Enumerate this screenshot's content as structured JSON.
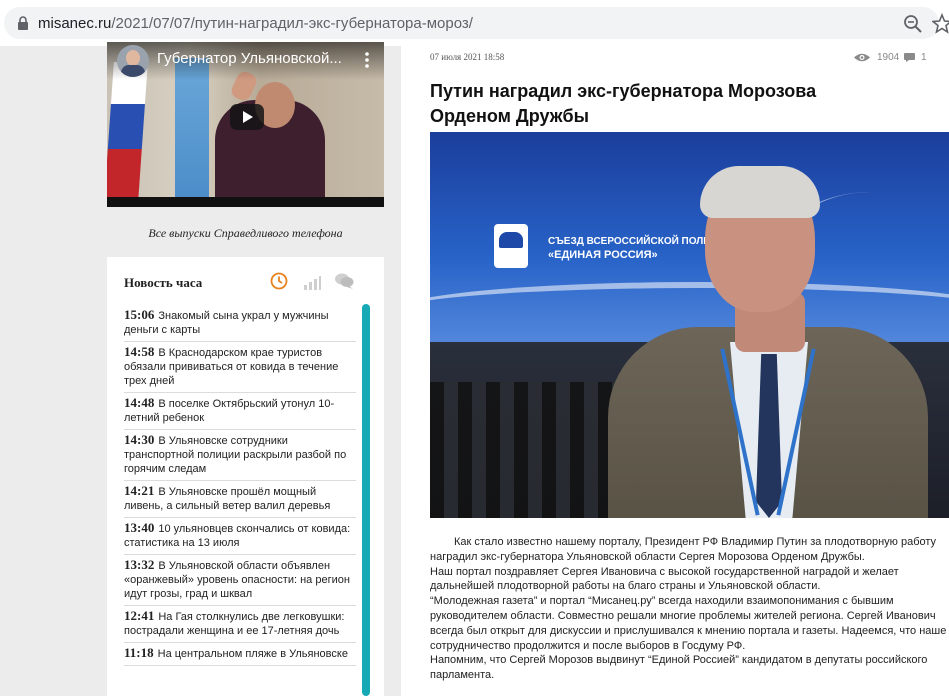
{
  "browser": {
    "url_domain": "misanec.ru",
    "url_path": "/2021/07/07/путин-наградил-экс-губернатора-мороз/"
  },
  "video": {
    "title": "Губернатор Ульяновской..."
  },
  "episodes_link": "Все выпуски Справедливого телефона",
  "news_hour": {
    "title": "Новость часа",
    "items": [
      {
        "time": "15:06",
        "text": "Знакомый сына украл у мужчины деньги с карты"
      },
      {
        "time": "14:58",
        "text": "В Краснодарском крае туристов обязали прививаться от ковида в течение трех дней"
      },
      {
        "time": "14:48",
        "text": "В поселке Октябрьский утонул 10-летний ребенок"
      },
      {
        "time": "14:30",
        "text": "В Ульяновске сотрудники транспортной полиции раскрыли разбой по горячим следам"
      },
      {
        "time": "14:21",
        "text": "В Ульяновске прошёл мощный ливень, а сильный ветер валил деревья"
      },
      {
        "time": "13:40",
        "text": "10 ульяновцев скончались от ковида: статистика на 13 июля"
      },
      {
        "time": "13:32",
        "text": "В Ульяновской области объявлен «оранжевый» уровень опасности: на регион идут грозы, град и шквал"
      },
      {
        "time": "12:41",
        "text": "На Гая столкнулись две легковушки: пострадали женщина и ее 17-летняя дочь"
      },
      {
        "time": "11:18",
        "text": "На центральном пляже в Ульяновске"
      }
    ]
  },
  "article": {
    "date": "07 июля 2021 18:58",
    "views": "1904",
    "comments": "1",
    "headline": "Путин наградил экс-губернатора Морозова Орденом Дружбы",
    "photo_text_line1": "СЪЕЗД ВСЕРОССИЙСКОЙ ПОЛИТИЧЕ",
    "photo_text_line2": "«ЕДИНАЯ РОССИЯ»",
    "paragraphs": [
      "Как стало известно нашему порталу, Президент РФ Владимир Путин за плодотворную работу наградил экс-губернатора Ульяновской области Сергея Морозова Орденом Дружбы.",
      "Наш портал поздравляет Сергея Ивановича с высокой государственной наградой и желает дальнейшей плодотворной работы на благо страны и Ульяновской области.",
      "“Молодежная газета” и портал “Мисанец.ру” всегда находили взаимопонимания с бывшим руководителем области. Совместно решали многие проблемы жителей региона. Сергей Иванович всегда был открыт для дискуссии и прислушивался к мнению портала и газеты. Надеемся, что наше сотрудничество продолжится и после выборов в Госдуму РФ.",
      "Напомним, что Сергей Морозов выдвинут “Единой Россией” кандидатом в депутаты российского парламента."
    ]
  },
  "colors": {
    "accent_teal": "#18a9b7",
    "clock_orange": "#e8821e"
  },
  "icons": [
    "lock-icon",
    "zoom-icon",
    "star-icon",
    "kebab-icon",
    "play-icon",
    "clock-icon",
    "bars-icon",
    "chat-icon",
    "eye-icon",
    "comment-icon"
  ]
}
